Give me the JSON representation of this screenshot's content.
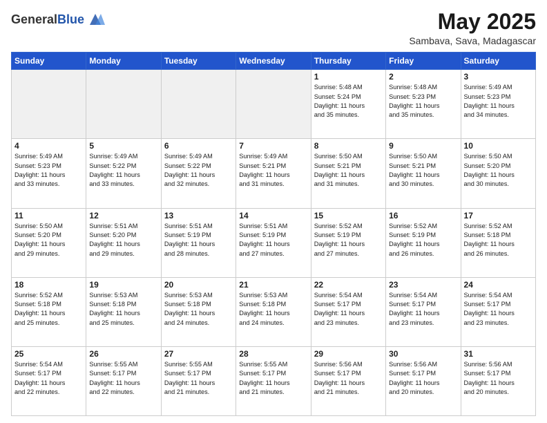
{
  "header": {
    "logo_general": "General",
    "logo_blue": "Blue",
    "title": "May 2025",
    "subtitle": "Sambava, Sava, Madagascar"
  },
  "weekdays": [
    "Sunday",
    "Monday",
    "Tuesday",
    "Wednesday",
    "Thursday",
    "Friday",
    "Saturday"
  ],
  "weeks": [
    [
      {
        "day": "",
        "info": ""
      },
      {
        "day": "",
        "info": ""
      },
      {
        "day": "",
        "info": ""
      },
      {
        "day": "",
        "info": ""
      },
      {
        "day": "1",
        "info": "Sunrise: 5:48 AM\nSunset: 5:24 PM\nDaylight: 11 hours\nand 35 minutes."
      },
      {
        "day": "2",
        "info": "Sunrise: 5:48 AM\nSunset: 5:23 PM\nDaylight: 11 hours\nand 35 minutes."
      },
      {
        "day": "3",
        "info": "Sunrise: 5:49 AM\nSunset: 5:23 PM\nDaylight: 11 hours\nand 34 minutes."
      }
    ],
    [
      {
        "day": "4",
        "info": "Sunrise: 5:49 AM\nSunset: 5:23 PM\nDaylight: 11 hours\nand 33 minutes."
      },
      {
        "day": "5",
        "info": "Sunrise: 5:49 AM\nSunset: 5:22 PM\nDaylight: 11 hours\nand 33 minutes."
      },
      {
        "day": "6",
        "info": "Sunrise: 5:49 AM\nSunset: 5:22 PM\nDaylight: 11 hours\nand 32 minutes."
      },
      {
        "day": "7",
        "info": "Sunrise: 5:49 AM\nSunset: 5:21 PM\nDaylight: 11 hours\nand 31 minutes."
      },
      {
        "day": "8",
        "info": "Sunrise: 5:50 AM\nSunset: 5:21 PM\nDaylight: 11 hours\nand 31 minutes."
      },
      {
        "day": "9",
        "info": "Sunrise: 5:50 AM\nSunset: 5:21 PM\nDaylight: 11 hours\nand 30 minutes."
      },
      {
        "day": "10",
        "info": "Sunrise: 5:50 AM\nSunset: 5:20 PM\nDaylight: 11 hours\nand 30 minutes."
      }
    ],
    [
      {
        "day": "11",
        "info": "Sunrise: 5:50 AM\nSunset: 5:20 PM\nDaylight: 11 hours\nand 29 minutes."
      },
      {
        "day": "12",
        "info": "Sunrise: 5:51 AM\nSunset: 5:20 PM\nDaylight: 11 hours\nand 29 minutes."
      },
      {
        "day": "13",
        "info": "Sunrise: 5:51 AM\nSunset: 5:19 PM\nDaylight: 11 hours\nand 28 minutes."
      },
      {
        "day": "14",
        "info": "Sunrise: 5:51 AM\nSunset: 5:19 PM\nDaylight: 11 hours\nand 27 minutes."
      },
      {
        "day": "15",
        "info": "Sunrise: 5:52 AM\nSunset: 5:19 PM\nDaylight: 11 hours\nand 27 minutes."
      },
      {
        "day": "16",
        "info": "Sunrise: 5:52 AM\nSunset: 5:19 PM\nDaylight: 11 hours\nand 26 minutes."
      },
      {
        "day": "17",
        "info": "Sunrise: 5:52 AM\nSunset: 5:18 PM\nDaylight: 11 hours\nand 26 minutes."
      }
    ],
    [
      {
        "day": "18",
        "info": "Sunrise: 5:52 AM\nSunset: 5:18 PM\nDaylight: 11 hours\nand 25 minutes."
      },
      {
        "day": "19",
        "info": "Sunrise: 5:53 AM\nSunset: 5:18 PM\nDaylight: 11 hours\nand 25 minutes."
      },
      {
        "day": "20",
        "info": "Sunrise: 5:53 AM\nSunset: 5:18 PM\nDaylight: 11 hours\nand 24 minutes."
      },
      {
        "day": "21",
        "info": "Sunrise: 5:53 AM\nSunset: 5:18 PM\nDaylight: 11 hours\nand 24 minutes."
      },
      {
        "day": "22",
        "info": "Sunrise: 5:54 AM\nSunset: 5:17 PM\nDaylight: 11 hours\nand 23 minutes."
      },
      {
        "day": "23",
        "info": "Sunrise: 5:54 AM\nSunset: 5:17 PM\nDaylight: 11 hours\nand 23 minutes."
      },
      {
        "day": "24",
        "info": "Sunrise: 5:54 AM\nSunset: 5:17 PM\nDaylight: 11 hours\nand 23 minutes."
      }
    ],
    [
      {
        "day": "25",
        "info": "Sunrise: 5:54 AM\nSunset: 5:17 PM\nDaylight: 11 hours\nand 22 minutes."
      },
      {
        "day": "26",
        "info": "Sunrise: 5:55 AM\nSunset: 5:17 PM\nDaylight: 11 hours\nand 22 minutes."
      },
      {
        "day": "27",
        "info": "Sunrise: 5:55 AM\nSunset: 5:17 PM\nDaylight: 11 hours\nand 21 minutes."
      },
      {
        "day": "28",
        "info": "Sunrise: 5:55 AM\nSunset: 5:17 PM\nDaylight: 11 hours\nand 21 minutes."
      },
      {
        "day": "29",
        "info": "Sunrise: 5:56 AM\nSunset: 5:17 PM\nDaylight: 11 hours\nand 21 minutes."
      },
      {
        "day": "30",
        "info": "Sunrise: 5:56 AM\nSunset: 5:17 PM\nDaylight: 11 hours\nand 20 minutes."
      },
      {
        "day": "31",
        "info": "Sunrise: 5:56 AM\nSunset: 5:17 PM\nDaylight: 11 hours\nand 20 minutes."
      }
    ]
  ]
}
